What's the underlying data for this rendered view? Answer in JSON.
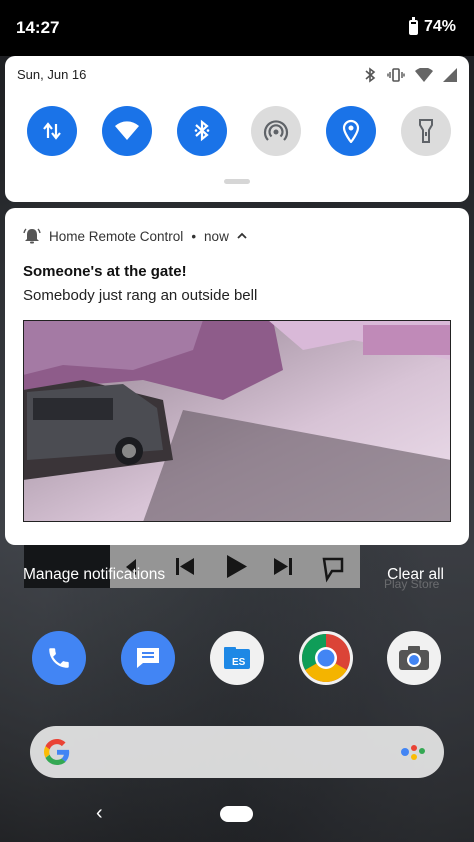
{
  "status_bar": {
    "time": "14:27",
    "battery": "74%"
  },
  "quick_settings": {
    "date": "Sun, Jun 16",
    "tiles": [
      {
        "name": "mobile-data",
        "state": "on"
      },
      {
        "name": "wifi",
        "state": "on"
      },
      {
        "name": "bluetooth",
        "state": "on"
      },
      {
        "name": "hotspot",
        "state": "off"
      },
      {
        "name": "location",
        "state": "on"
      },
      {
        "name": "flashlight",
        "state": "off"
      }
    ]
  },
  "notification": {
    "app_name": "Home Remote Control",
    "separator": "•",
    "when": "now",
    "title": "Someone's at the gate!",
    "text": "Somebody just rang an outside bell"
  },
  "shade_actions": {
    "manage": "Manage notifications",
    "clear_all": "Clear all"
  },
  "home_screen": {
    "play_store_label": "Play Store"
  },
  "colors": {
    "accent": "#1a73e8",
    "tile_off": "#dcdcdc"
  }
}
